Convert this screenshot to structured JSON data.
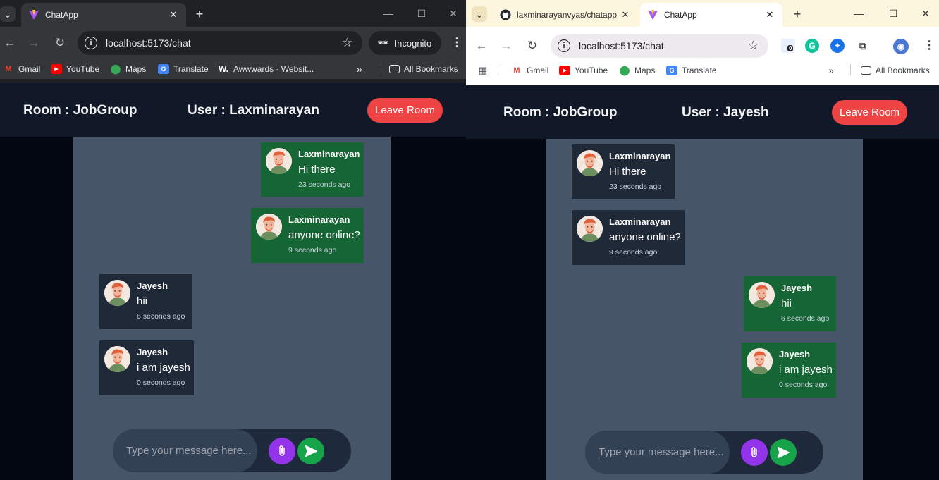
{
  "colors": {
    "header_bg": "#111827",
    "panel_bg": "#475569",
    "own_message_bg": "#166534",
    "other_message_bg": "#1f2937",
    "leave_button": "#ef4444",
    "attach_button": "#9333ea",
    "send_button": "#16a34a"
  },
  "left_window": {
    "tabs": [
      {
        "label": "ChatApp",
        "icon": "vite-icon"
      }
    ],
    "url": "localhost:5173/chat",
    "incognito_label": "Incognito",
    "bookmarks": [
      {
        "label": "Gmail",
        "icon": "gmail-icon"
      },
      {
        "label": "YouTube",
        "icon": "youtube-icon"
      },
      {
        "label": "Maps",
        "icon": "maps-icon"
      },
      {
        "label": "Translate",
        "icon": "translate-icon"
      },
      {
        "label": "Awwwards - Websit...",
        "icon": "awwwards-icon"
      }
    ],
    "all_bookmarks": "All Bookmarks",
    "app": {
      "room": "Room : JobGroup",
      "user": "User : Laxminarayan",
      "leave_label": "Leave Room",
      "messages": [
        {
          "name": "Laxminarayan",
          "text": "Hi there",
          "time": "23 seconds ago",
          "own": true
        },
        {
          "name": "Laxminarayan",
          "text": "anyone online?",
          "time": "9 seconds ago",
          "own": true
        },
        {
          "name": "Jayesh",
          "text": "hii",
          "time": "6 seconds ago",
          "own": false
        },
        {
          "name": "Jayesh",
          "text": "i am jayesh",
          "time": "0 seconds ago",
          "own": false
        }
      ],
      "placeholder": "Type your message here..."
    }
  },
  "right_window": {
    "tabs": [
      {
        "label": "laxminarayanvyas/chatapp",
        "icon": "github-icon"
      },
      {
        "label": "ChatApp",
        "icon": "vite-icon"
      }
    ],
    "url": "localhost:5173/chat",
    "extension_badge": "0",
    "bookmarks": [
      {
        "label": "Gmail",
        "icon": "gmail-icon"
      },
      {
        "label": "YouTube",
        "icon": "youtube-icon"
      },
      {
        "label": "Maps",
        "icon": "maps-icon"
      },
      {
        "label": "Translate",
        "icon": "translate-icon"
      }
    ],
    "all_bookmarks": "All Bookmarks",
    "app": {
      "room": "Room : JobGroup",
      "user": "User : Jayesh",
      "leave_label": "Leave Room",
      "messages": [
        {
          "name": "Laxminarayan",
          "text": "Hi there",
          "time": "23 seconds ago",
          "own": false
        },
        {
          "name": "Laxminarayan",
          "text": "anyone online?",
          "time": "9 seconds ago",
          "own": false
        },
        {
          "name": "Jayesh",
          "text": "hii",
          "time": "6 seconds ago",
          "own": true
        },
        {
          "name": "Jayesh",
          "text": "i am jayesh",
          "time": "0 seconds ago",
          "own": true
        }
      ],
      "placeholder": "Type your message here..."
    }
  }
}
